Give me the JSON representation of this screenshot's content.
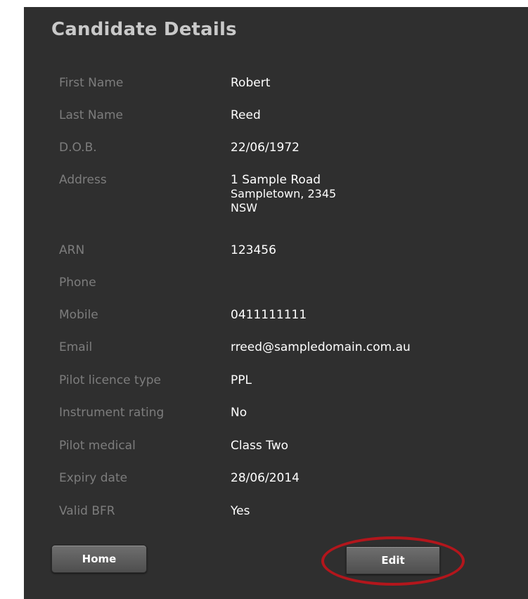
{
  "page": {
    "title": "Candidate Details"
  },
  "details": [
    {
      "label": "First Name",
      "value": [
        "Robert"
      ]
    },
    {
      "label": "Last Name",
      "value": [
        "Reed"
      ]
    },
    {
      "label": "D.O.B.",
      "value": [
        "22/06/1972"
      ]
    },
    {
      "label": "Address",
      "value": [
        "1 Sample Road",
        "Sampletown, 2345",
        "NSW"
      ]
    },
    {
      "label": "ARN",
      "value": [
        "123456"
      ]
    },
    {
      "label": "Phone",
      "value": [
        ""
      ]
    },
    {
      "label": "Mobile",
      "value": [
        "0411111111"
      ]
    },
    {
      "label": "Email",
      "value": [
        "rreed@sampledomain.com.au"
      ]
    },
    {
      "label": "Pilot licence type",
      "value": [
        "PPL"
      ]
    },
    {
      "label": "Instrument rating",
      "value": [
        "No"
      ]
    },
    {
      "label": "Pilot medical",
      "value": [
        "Class Two"
      ]
    },
    {
      "label": "Expiry date",
      "value": [
        "28/06/2014"
      ]
    },
    {
      "label": "Valid BFR",
      "value": [
        "Yes"
      ]
    }
  ],
  "buttons": {
    "home_label": "Home",
    "edit_label": "Edit"
  },
  "colors": {
    "panel_background": "#2f2f2f",
    "label_text": "#7d7d7d",
    "value_text": "#ffffff",
    "title_text": "#c9c9c9",
    "highlight_ring": "#b3161c"
  }
}
